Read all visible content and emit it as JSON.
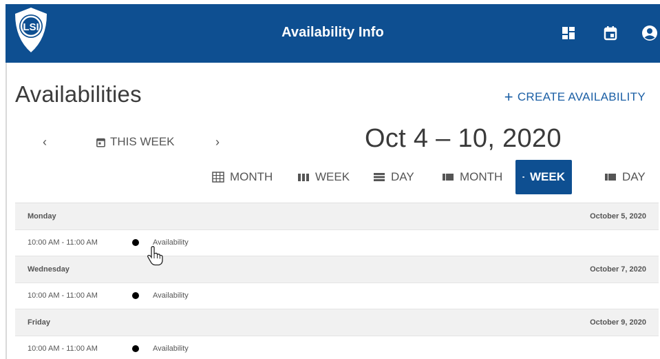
{
  "appbar": {
    "title": "Availability Info",
    "brand_color": "#0e4f91",
    "logo_text": "LSI",
    "icons": [
      "dashboard-icon",
      "calendar-icon",
      "account-icon"
    ]
  },
  "page": {
    "title": "Availabilities",
    "create_label": "CREATE AVAILABILITY",
    "create_icon": "plus-icon"
  },
  "toolbar": {
    "prev_label": "‹",
    "next_label": "›",
    "this_week_label": "THIS WEEK",
    "range_title": "Oct 4 – 10, 2020"
  },
  "views": [
    {
      "label": "MONTH",
      "icon": "grid-calendar-icon",
      "active": false
    },
    {
      "label": "WEEK",
      "icon": "week-columns-icon",
      "active": false
    },
    {
      "label": "DAY",
      "icon": "day-list-icon",
      "active": false
    },
    {
      "label": "MONTH",
      "icon": "agenda-month-icon",
      "active": false
    },
    {
      "label": "WEEK",
      "icon": "agenda-week-icon",
      "active": true
    },
    {
      "label": "DAY",
      "icon": "agenda-day-icon",
      "active": false
    }
  ],
  "agenda": [
    {
      "day": "Monday",
      "date": "October 5, 2020",
      "events": [
        {
          "time": "10:00 AM - 11:00 AM",
          "title": "Availability"
        }
      ]
    },
    {
      "day": "Wednesday",
      "date": "October 7, 2020",
      "events": [
        {
          "time": "10:00 AM - 11:00 AM",
          "title": "Availability"
        }
      ]
    },
    {
      "day": "Friday",
      "date": "October 9, 2020",
      "events": [
        {
          "time": "10:00 AM - 11:00 AM",
          "title": "Availability"
        }
      ]
    }
  ]
}
